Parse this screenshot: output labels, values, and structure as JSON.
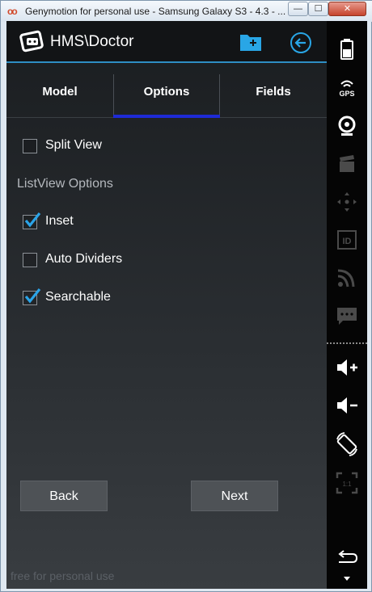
{
  "window": {
    "title": "Genymotion for personal use - Samsung Galaxy S3 - 4.3 - ...",
    "icon_text": "oo",
    "min_glyph": "—",
    "max_glyph": "☐",
    "close_glyph": "✕"
  },
  "app": {
    "title": "HMS\\Doctor"
  },
  "tabs": [
    {
      "label": "Model"
    },
    {
      "label": "Options"
    },
    {
      "label": "Fields"
    }
  ],
  "options": {
    "split_view": {
      "label": "Split View",
      "checked": false
    },
    "section_header": "ListView Options",
    "inset": {
      "label": "Inset",
      "checked": true
    },
    "auto_dividers": {
      "label": "Auto Dividers",
      "checked": false
    },
    "searchable": {
      "label": "Searchable",
      "checked": true
    }
  },
  "buttons": {
    "back_label": "Back",
    "next_label": "Next"
  },
  "watermark": "free for personal use",
  "sidebar": {
    "gps_label": "GPS",
    "id_label": "ID",
    "ratio_label": "1:1"
  },
  "colors": {
    "accent": "#2e8fc4",
    "tab_indicator": "#1e2bd6",
    "check": "#2ba4e8"
  }
}
